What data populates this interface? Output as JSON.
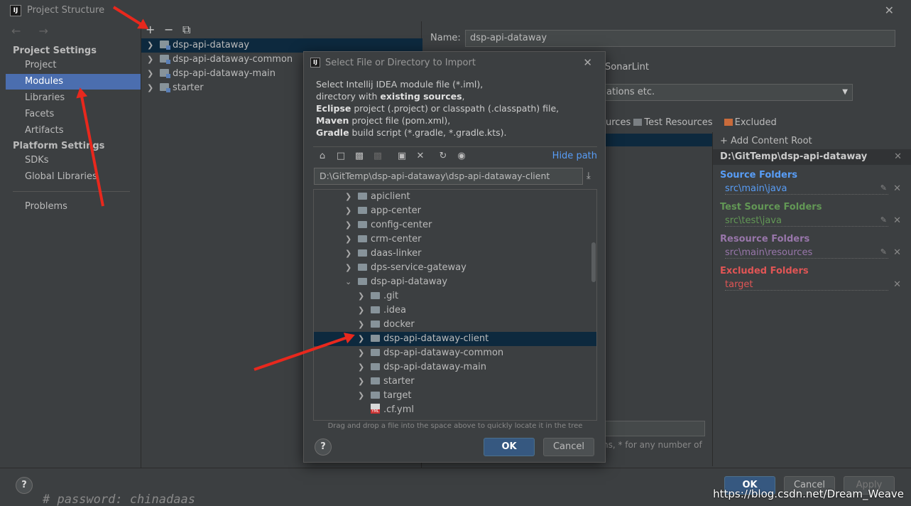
{
  "window": {
    "title": "Project Structure",
    "close": "✕"
  },
  "sidebar": {
    "nav": "← →",
    "project_settings_header": "Project Settings",
    "platform_settings_header": "Platform Settings",
    "items": [
      {
        "label": "Project"
      },
      {
        "label": "Modules"
      },
      {
        "label": "Libraries"
      },
      {
        "label": "Facets"
      },
      {
        "label": "Artifacts"
      },
      {
        "label": "SDKs"
      },
      {
        "label": "Global Libraries"
      },
      {
        "label": "Problems"
      }
    ],
    "selected": "Modules"
  },
  "module_toolbar": {
    "add": "+",
    "remove": "−",
    "copy": "⧉"
  },
  "modules": [
    {
      "name": "dsp-api-dataway",
      "selected": true
    },
    {
      "name": "dsp-api-dataway-common"
    },
    {
      "name": "dsp-api-dataway-main"
    },
    {
      "name": "starter"
    }
  ],
  "detail": {
    "name_label": "Name:",
    "name_value": "dsp-api-dataway",
    "sonarlint": "SonarLint",
    "combo_value": "ations etc.",
    "mark_sources_tail": "urces",
    "mark_test_resources": "Test Resources",
    "mark_excluded": "Excluded",
    "add_content_root": "Add Content Root",
    "content_root_path": "D:\\GitTemp\\dsp-api-dataway",
    "source_folders_label": "Source Folders",
    "source_folders_value": "src\\main\\java",
    "test_source_folders_label": "Test Source Folders",
    "test_source_folders_value": "src\\test\\java",
    "resource_folders_label": "Resource Folders",
    "resource_folders_value": "src\\main\\resources",
    "excluded_folders_label": "Excluded Folders",
    "excluded_folders_value": "target",
    "hint_text": "ns, * for any number of"
  },
  "colors": {
    "source": "#589df6",
    "test": "#629755",
    "resource": "#9876aa",
    "excluded": "#e05555",
    "selection": "#4b6eaf",
    "tree_selection": "#0d293e",
    "primary_button": "#365880",
    "annotation": "#e8281d"
  },
  "dialog": {
    "title": "Select File or Directory to Import",
    "close": "✕",
    "description": {
      "line1": "Select Intellij IDEA module file (*.iml),",
      "line2_pre": "directory with ",
      "line2_bold": "existing sources",
      "line2_post": ",",
      "line3_bold": "Eclipse",
      "line3_post": " project (.project) or classpath (.classpath) file,",
      "line4_bold": "Maven",
      "line4_post": " project file (pom.xml),",
      "line5_bold": "Gradle",
      "line5_post": " build script (*.gradle, *.gradle.kts)."
    },
    "toolbar_icons": [
      "home-icon",
      "desktop-icon",
      "project-folder-icon",
      "module-folder-icon",
      "new-folder-icon",
      "delete-icon",
      "refresh-icon",
      "show-hidden-icon"
    ],
    "hide_path": "Hide path",
    "path_value": "D:\\GitTemp\\dsp-api-dataway\\dsp-api-dataway-client",
    "tree": [
      {
        "name": "apiclient",
        "level": 0,
        "expanded": false
      },
      {
        "name": "app-center",
        "level": 0,
        "expanded": false
      },
      {
        "name": "config-center",
        "level": 0,
        "expanded": false
      },
      {
        "name": "crm-center",
        "level": 0,
        "expanded": false
      },
      {
        "name": "daas-linker",
        "level": 0,
        "expanded": false
      },
      {
        "name": "dps-service-gateway",
        "level": 0,
        "expanded": false
      },
      {
        "name": "dsp-api-dataway",
        "level": 0,
        "expanded": true
      },
      {
        "name": ".git",
        "level": 1,
        "expanded": false
      },
      {
        "name": ".idea",
        "level": 1,
        "expanded": false
      },
      {
        "name": "docker",
        "level": 1,
        "expanded": false
      },
      {
        "name": "dsp-api-dataway-client",
        "level": 1,
        "expanded": false,
        "selected": true
      },
      {
        "name": "dsp-api-dataway-common",
        "level": 1,
        "expanded": false
      },
      {
        "name": "dsp-api-dataway-main",
        "level": 1,
        "expanded": false
      },
      {
        "name": "starter",
        "level": 1,
        "expanded": false
      },
      {
        "name": "target",
        "level": 1,
        "expanded": false
      },
      {
        "name": ".cf.yml",
        "level": 1,
        "file": true
      }
    ],
    "dnd_hint": "Drag and drop a file into the space above to quickly locate it in the tree",
    "help": "?",
    "ok": "OK",
    "cancel": "Cancel"
  },
  "bottom": {
    "help": "?",
    "ok": "OK",
    "cancel": "Cancel",
    "apply": "Apply"
  },
  "editor_text": "#     password: chinadaas",
  "watermark": "https://blog.csdn.net/Dream_Weave"
}
